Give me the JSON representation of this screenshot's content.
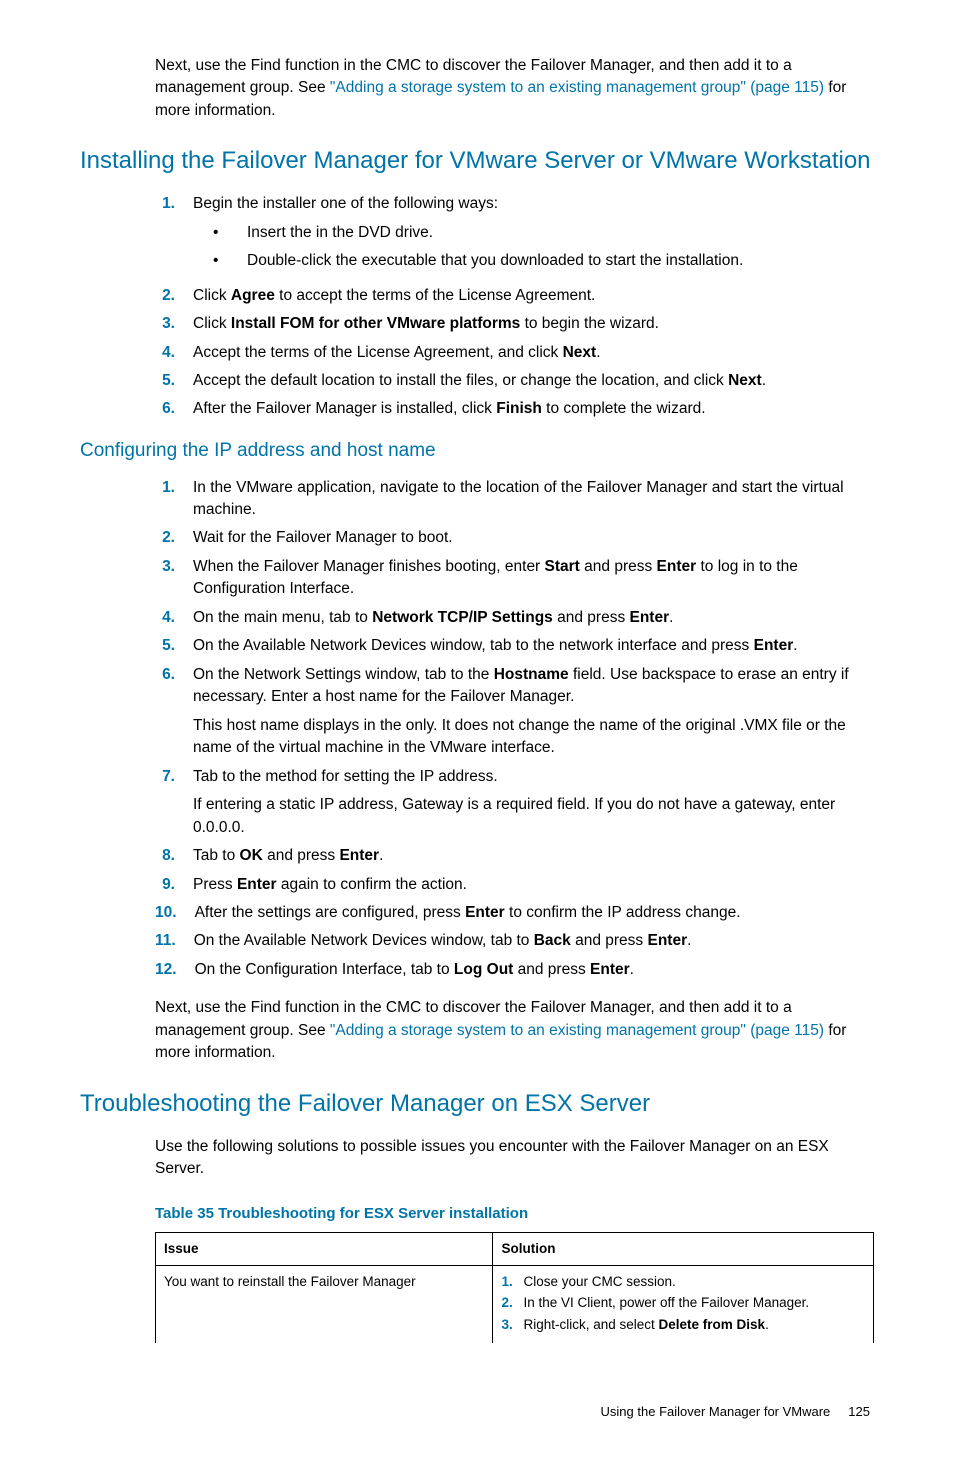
{
  "intro1_a": "Next, use the Find function in the CMC to discover the Failover Manager, and then add it to a management group. See ",
  "intro1_link": "\"Adding a storage system to an existing management group\" (page 115)",
  "intro1_b": " for more information.",
  "h2a": "Installing the Failover Manager for VMware Server or VMware Workstation",
  "h2a_steps": [
    {
      "num": "1.",
      "parts": [
        {
          "t": "Begin the installer one of the following ways:"
        }
      ],
      "bullets": [
        "Insert the in the DVD drive.",
        "Double-click the executable that you downloaded to start the installation."
      ]
    },
    {
      "num": "2.",
      "parts": [
        {
          "t": "Click "
        },
        {
          "t": "Agree",
          "b": true
        },
        {
          "t": " to accept the terms of the License Agreement."
        }
      ]
    },
    {
      "num": "3.",
      "parts": [
        {
          "t": "Click "
        },
        {
          "t": "Install FOM for other VMware platforms",
          "b": true
        },
        {
          "t": " to begin the wizard."
        }
      ]
    },
    {
      "num": "4.",
      "parts": [
        {
          "t": "Accept the terms of the License Agreement, and click "
        },
        {
          "t": "Next",
          "b": true
        },
        {
          "t": "."
        }
      ]
    },
    {
      "num": "5.",
      "parts": [
        {
          "t": "Accept the default location to install the files, or change the location, and click "
        },
        {
          "t": "Next",
          "b": true
        },
        {
          "t": "."
        }
      ]
    },
    {
      "num": "6.",
      "parts": [
        {
          "t": "After the Failover Manager is installed, click "
        },
        {
          "t": "Finish",
          "b": true
        },
        {
          "t": " to complete the wizard."
        }
      ]
    }
  ],
  "h3a": "Configuring the IP address and host name",
  "h3a_steps": [
    {
      "num": "1.",
      "parts": [
        {
          "t": "In the VMware application, navigate to the location of the Failover Manager and start the virtual machine."
        }
      ]
    },
    {
      "num": "2.",
      "parts": [
        {
          "t": "Wait for the Failover Manager to boot."
        }
      ]
    },
    {
      "num": "3.",
      "parts": [
        {
          "t": "When the Failover Manager finishes booting, enter "
        },
        {
          "t": "Start",
          "b": true
        },
        {
          "t": " and press "
        },
        {
          "t": "Enter",
          "b": true
        },
        {
          "t": " to log in to the Configuration Interface."
        }
      ]
    },
    {
      "num": "4.",
      "parts": [
        {
          "t": "On the main menu, tab to "
        },
        {
          "t": "Network TCP/IP Settings",
          "b": true
        },
        {
          "t": " and press "
        },
        {
          "t": "Enter",
          "b": true
        },
        {
          "t": "."
        }
      ]
    },
    {
      "num": "5.",
      "parts": [
        {
          "t": "On the Available Network Devices window, tab to the network interface and press "
        },
        {
          "t": "Enter",
          "b": true
        },
        {
          "t": "."
        }
      ]
    },
    {
      "num": "6.",
      "parts": [
        {
          "t": "On the Network Settings window, tab to the "
        },
        {
          "t": "Hostname",
          "b": true
        },
        {
          "t": " field. Use backspace to erase an entry if necessary. Enter a host name for the Failover Manager."
        }
      ],
      "sub": "This host name displays in the only. It does not change the name of the original .VMX file or the name of the virtual machine in the VMware interface."
    },
    {
      "num": "7.",
      "parts": [
        {
          "t": "Tab to the method for setting the IP address."
        }
      ],
      "sub": "If entering a static IP address, Gateway is a required field. If you do not have a gateway, enter 0.0.0.0."
    },
    {
      "num": "8.",
      "parts": [
        {
          "t": "Tab to "
        },
        {
          "t": "OK",
          "b": true
        },
        {
          "t": " and press "
        },
        {
          "t": "Enter",
          "b": true
        },
        {
          "t": "."
        }
      ]
    },
    {
      "num": "9.",
      "parts": [
        {
          "t": "Press "
        },
        {
          "t": "Enter",
          "b": true
        },
        {
          "t": " again to confirm the action."
        }
      ]
    },
    {
      "num": "10.",
      "parts": [
        {
          "t": "After the settings are configured, press "
        },
        {
          "t": "Enter",
          "b": true
        },
        {
          "t": " to confirm the IP address change."
        }
      ]
    },
    {
      "num": "11.",
      "parts": [
        {
          "t": "On the Available Network Devices window, tab to "
        },
        {
          "t": "Back",
          "b": true
        },
        {
          "t": " and press "
        },
        {
          "t": "Enter",
          "b": true
        },
        {
          "t": "."
        }
      ]
    },
    {
      "num": "12.",
      "parts": [
        {
          "t": "On the Configuration Interface, tab to "
        },
        {
          "t": "Log Out",
          "b": true
        },
        {
          "t": " and press "
        },
        {
          "t": "Enter",
          "b": true
        },
        {
          "t": "."
        }
      ]
    }
  ],
  "intro2_a": "Next, use the Find function in the CMC to discover the Failover Manager, and then add it to a management group. See ",
  "intro2_link": "\"Adding a storage system to an existing management group\" (page 115)",
  "intro2_b": " for more information.",
  "h2b": "Troubleshooting the Failover Manager on ESX Server",
  "h2b_intro": "Use the following solutions to possible issues you encounter with the Failover Manager on an ESX Server.",
  "table_caption": "Table 35 Troubleshooting for ESX Server installation",
  "table_headers": [
    "Issue",
    "Solution"
  ],
  "table_row": {
    "issue": "You want to reinstall the Failover Manager",
    "solution": [
      {
        "n": "1.",
        "parts": [
          {
            "t": "Close your CMC session."
          }
        ]
      },
      {
        "n": "2.",
        "parts": [
          {
            "t": "In the VI Client, power off the Failover Manager."
          }
        ]
      },
      {
        "n": "3.",
        "parts": [
          {
            "t": "Right-click, and select "
          },
          {
            "t": "Delete from Disk",
            "b": true
          },
          {
            "t": "."
          }
        ]
      }
    ]
  },
  "footer_text": "Using the Failover Manager for VMware",
  "footer_page": "125"
}
